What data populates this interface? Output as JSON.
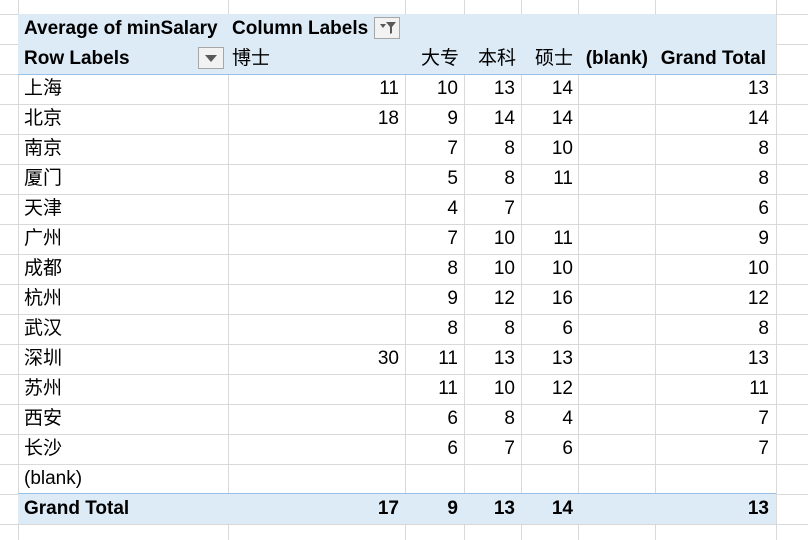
{
  "pivot": {
    "value_label": "Average of minSalary",
    "column_labels": "Column Labels",
    "row_labels": "Row Labels",
    "columns": [
      "博士",
      "大专",
      "本科",
      "硕士",
      "(blank)",
      "Grand Total"
    ],
    "rows": [
      {
        "label": "上海",
        "values": [
          "11",
          "10",
          "13",
          "14",
          "",
          "13"
        ]
      },
      {
        "label": "北京",
        "values": [
          "18",
          "9",
          "14",
          "14",
          "",
          "14"
        ]
      },
      {
        "label": "南京",
        "values": [
          "",
          "7",
          "8",
          "10",
          "",
          "8"
        ]
      },
      {
        "label": "厦门",
        "values": [
          "",
          "5",
          "8",
          "11",
          "",
          "8"
        ]
      },
      {
        "label": "天津",
        "values": [
          "",
          "4",
          "7",
          "",
          "",
          "6"
        ]
      },
      {
        "label": "广州",
        "values": [
          "",
          "7",
          "10",
          "11",
          "",
          "9"
        ]
      },
      {
        "label": "成都",
        "values": [
          "",
          "8",
          "10",
          "10",
          "",
          "10"
        ]
      },
      {
        "label": "杭州",
        "values": [
          "",
          "9",
          "12",
          "16",
          "",
          "12"
        ]
      },
      {
        "label": "武汉",
        "values": [
          "",
          "8",
          "8",
          "6",
          "",
          "8"
        ]
      },
      {
        "label": "深圳",
        "values": [
          "30",
          "11",
          "13",
          "13",
          "",
          "13"
        ]
      },
      {
        "label": "苏州",
        "values": [
          "",
          "11",
          "10",
          "12",
          "",
          "11"
        ]
      },
      {
        "label": "西安",
        "values": [
          "",
          "6",
          "8",
          "4",
          "",
          "7"
        ]
      },
      {
        "label": "长沙",
        "values": [
          "",
          "6",
          "7",
          "6",
          "",
          "7"
        ]
      },
      {
        "label": "(blank)",
        "values": [
          "",
          "",
          "",
          "",
          "",
          ""
        ]
      }
    ],
    "grand_total": {
      "label": "Grand Total",
      "values": [
        "17",
        "9",
        "13",
        "14",
        "",
        "13"
      ]
    }
  },
  "icons": {
    "column_filter": "filter-dropdown-icon",
    "row_filter": "dropdown-arrow-icon"
  },
  "colors": {
    "header_band": "#ddebf7",
    "band_border": "#9bc2e6",
    "gridline": "#d9d9d9"
  }
}
